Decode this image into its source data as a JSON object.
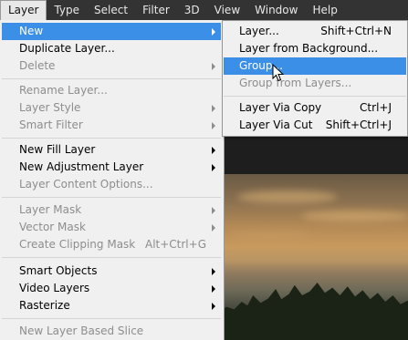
{
  "menubar": {
    "items": [
      "Layer",
      "Type",
      "Select",
      "Filter",
      "3D",
      "View",
      "Window",
      "Help"
    ]
  },
  "layer_menu": {
    "items": [
      {
        "label": "New",
        "submenu": true,
        "state": "highlighted"
      },
      {
        "label": "Duplicate Layer...",
        "state": "enabled"
      },
      {
        "label": "Delete",
        "submenu": true,
        "state": "disabled"
      },
      {
        "label": "Rename Layer...",
        "state": "disabled"
      },
      {
        "label": "Layer Style",
        "submenu": true,
        "state": "disabled"
      },
      {
        "label": "Smart Filter",
        "submenu": true,
        "state": "disabled"
      },
      {
        "label": "New Fill Layer",
        "submenu": true,
        "state": "enabled"
      },
      {
        "label": "New Adjustment Layer",
        "submenu": true,
        "state": "enabled"
      },
      {
        "label": "Layer Content Options...",
        "state": "disabled"
      },
      {
        "label": "Layer Mask",
        "submenu": true,
        "state": "disabled"
      },
      {
        "label": "Vector Mask",
        "submenu": true,
        "state": "disabled"
      },
      {
        "label": "Create Clipping Mask",
        "shortcut": "Alt+Ctrl+G",
        "state": "disabled"
      },
      {
        "label": "Smart Objects",
        "submenu": true,
        "state": "enabled"
      },
      {
        "label": "Video Layers",
        "submenu": true,
        "state": "enabled"
      },
      {
        "label": "Rasterize",
        "submenu": true,
        "state": "enabled"
      },
      {
        "label": "New Layer Based Slice",
        "state": "disabled"
      }
    ]
  },
  "new_submenu": {
    "items": [
      {
        "label": "Layer...",
        "shortcut": "Shift+Ctrl+N",
        "state": "enabled"
      },
      {
        "label": "Layer from Background...",
        "state": "enabled"
      },
      {
        "label": "Group...",
        "state": "highlighted"
      },
      {
        "label": "Group from Layers...",
        "state": "disabled"
      },
      {
        "label": "Layer Via Copy",
        "shortcut": "Ctrl+J",
        "state": "enabled"
      },
      {
        "label": "Layer Via Cut",
        "shortcut": "Shift+Ctrl+J",
        "state": "enabled"
      }
    ]
  },
  "colors": {
    "menubar_bg": "#333333",
    "menu_bg": "#f0f0f0",
    "highlight": "#3c8fe6",
    "disabled_text": "#8d8d8d"
  },
  "icons": {
    "cursor": "mouse-pointer-icon",
    "submenu_arrow": "chevron-right-icon"
  }
}
